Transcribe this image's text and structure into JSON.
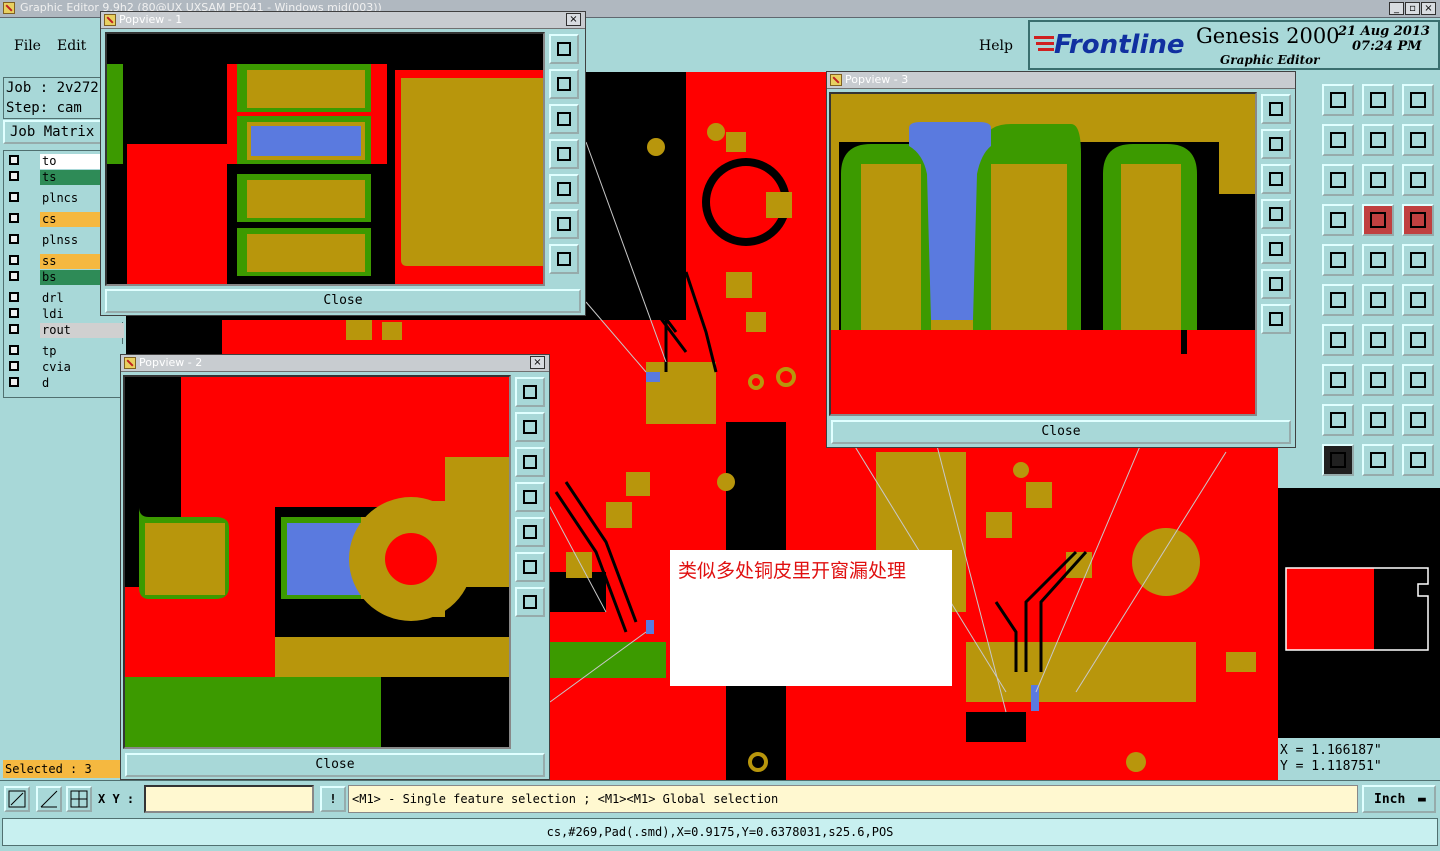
{
  "window": {
    "title": "Graphic Editor 9.9h2 (80@UX UXSAM PE041 - Windows mid(003))"
  },
  "menu": {
    "file": "File",
    "edit": "Edit",
    "help": "Help"
  },
  "brand": {
    "name": "Frontline",
    "product": "Genesis 2000",
    "subtitle": "Graphic Editor",
    "date": "21 Aug 2013",
    "time": "07:24 PM"
  },
  "job": {
    "job_line": "Job : 2v272",
    "step_line": "Step: cam",
    "matrix_button": "Job Matrix"
  },
  "layers": [
    {
      "name": "to",
      "color": "#ffffff"
    },
    {
      "name": "ts",
      "color": "#2e8b57"
    },
    {
      "name": "plncs",
      "color": "#a8d8d8"
    },
    {
      "name": "cs",
      "color": "#f5b840"
    },
    {
      "name": "plnss",
      "color": "#a8d8d8"
    },
    {
      "name": "ss",
      "color": "#f5b840"
    },
    {
      "name": "bs",
      "color": "#2e8b57"
    },
    {
      "name": "drl",
      "color": "#a8d8d8"
    },
    {
      "name": "ldi",
      "color": "#a8d8d8"
    },
    {
      "name": "rout",
      "color": "#d0d0d0"
    },
    {
      "name": "tp",
      "color": "#a8d8d8"
    },
    {
      "name": "cvia",
      "color": "#a8d8d8"
    },
    {
      "name": "d",
      "color": "#a8d8d8"
    }
  ],
  "selected": "Selected : 3",
  "coords": {
    "x": "X = 1.166187\"",
    "y": "Y = 1.118751\""
  },
  "command": {
    "xy_label": "X Y :",
    "input_value": "",
    "hint": "<M1> - Single feature selection ; <M1><M1> Global selection",
    "units": "Inch"
  },
  "status": "cs,#269,Pad(.smd),X=0.9175,Y=0.6378031,s25.6,POS",
  "popups": {
    "p1": {
      "title": "Popview - 1",
      "close": "Close"
    },
    "p2": {
      "title": "Popview - 2",
      "close": "Close"
    },
    "p3": {
      "title": "Popview - 3",
      "close": "Close"
    }
  },
  "annotation": "类似多处铜皮里开窗漏处理",
  "colors": {
    "copper": "#ff0000",
    "pad": "#b8960c",
    "mask": "#3c9a00",
    "window": "#5a7adf",
    "ui": "#a8d8d8"
  }
}
